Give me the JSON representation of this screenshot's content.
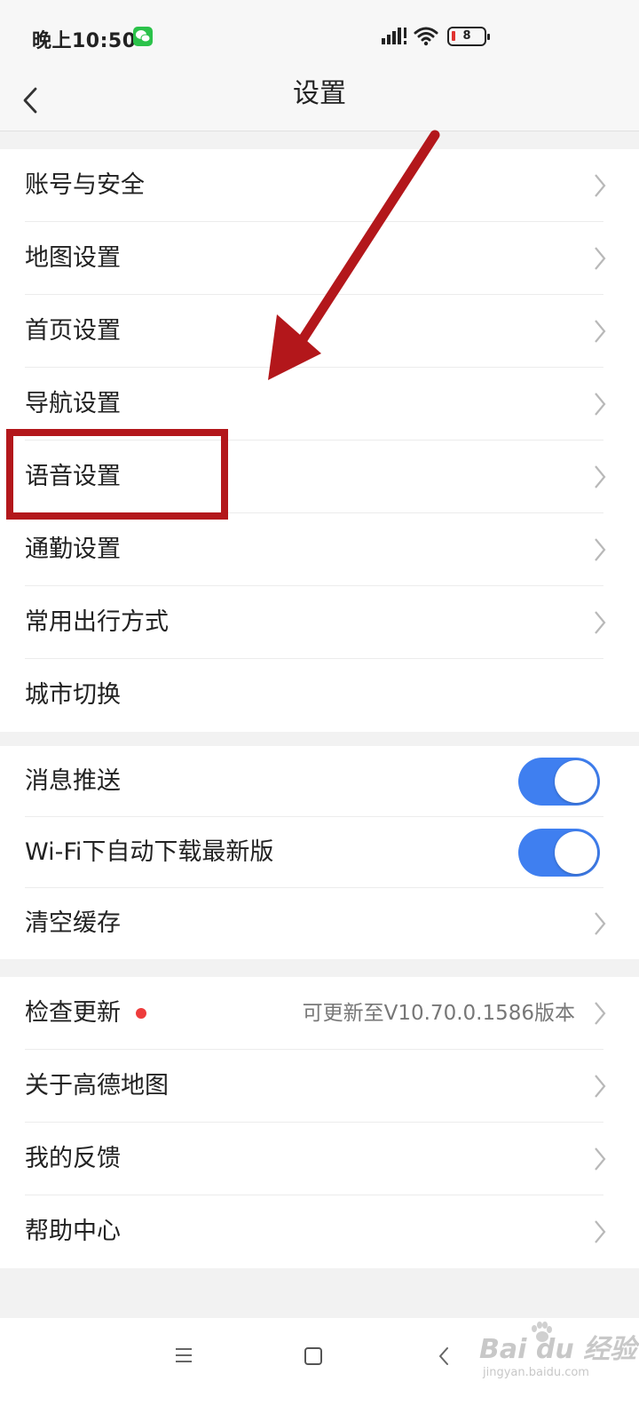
{
  "status_bar": {
    "time": "晚上10:50",
    "battery_level": "8",
    "icons": [
      "wechat-icon",
      "signal-icon",
      "wifi-icon",
      "battery-icon"
    ]
  },
  "header": {
    "title": "设置",
    "back_icon": "chevron-left-icon"
  },
  "groups": {
    "general": [
      {
        "label": "账号与安全",
        "chevron": true
      },
      {
        "label": "地图设置",
        "chevron": true
      },
      {
        "label": "首页设置",
        "chevron": true
      },
      {
        "label": "导航设置",
        "chevron": true
      },
      {
        "label": "语音设置",
        "chevron": true
      },
      {
        "label": "通勤设置",
        "chevron": true
      },
      {
        "label": "常用出行方式",
        "chevron": true
      },
      {
        "label": "城市切换",
        "chevron": false
      }
    ],
    "preferences": [
      {
        "label": "消息推送",
        "control": "toggle",
        "on": true
      },
      {
        "label": "Wi-Fi下自动下载最新版",
        "control": "toggle",
        "on": true
      },
      {
        "label": "清空缓存",
        "control": "chevron"
      }
    ],
    "about": [
      {
        "label": "检查更新",
        "badge": "red-dot",
        "value": "可更新至V10.70.0.1586版本",
        "chevron": true
      },
      {
        "label": "关于高德地图",
        "chevron": true
      },
      {
        "label": "我的反馈",
        "chevron": true
      },
      {
        "label": "帮助中心",
        "chevron": true
      }
    ]
  },
  "annotations": {
    "highlight_target": "语音设置",
    "arrow_color": "#b3171b",
    "box_color": "#b3171b"
  },
  "system_nav": {
    "icons": [
      "menu-nav-icon",
      "home-nav-icon",
      "back-nav-icon"
    ]
  },
  "watermark": {
    "main": "Bai du 经验",
    "sub": "jingyan.baidu.com"
  },
  "colors": {
    "toggle_on": "#3f7ff0",
    "badge": "#ee3c3c",
    "background": "#f2f2f2"
  }
}
